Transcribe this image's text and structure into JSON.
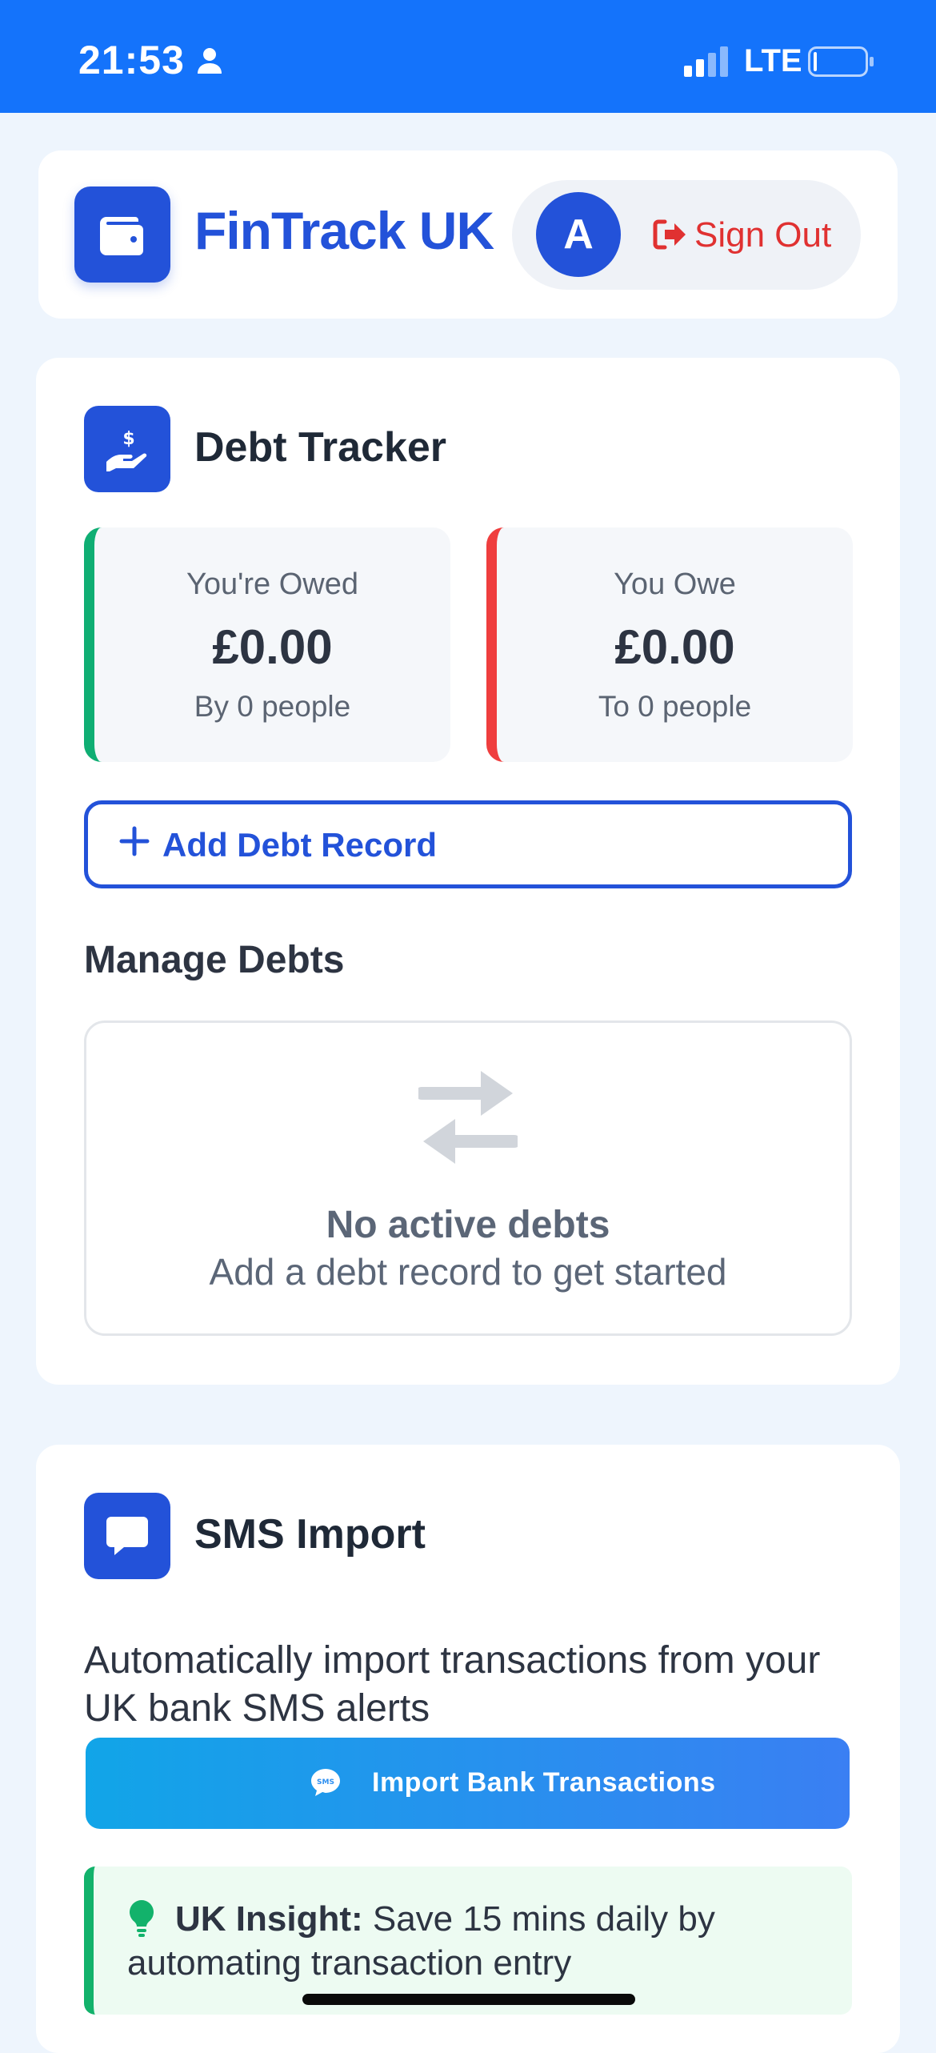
{
  "status_bar": {
    "time": "21:53",
    "network": "LTE",
    "icons": [
      "person-icon",
      "signal-icon",
      "battery-icon"
    ]
  },
  "header": {
    "brand": "FinTrack UK",
    "avatar_initial": "A",
    "sign_out_label": "Sign Out",
    "icons": [
      "wallet-icon",
      "sign-out-icon"
    ]
  },
  "debt_tracker": {
    "title": "Debt Tracker",
    "owed": {
      "label": "You're Owed",
      "amount": "£0.00",
      "sub": "By 0 people"
    },
    "owe": {
      "label": "You Owe",
      "amount": "£0.00",
      "sub": "To 0 people"
    },
    "add_button_label": "Add Debt Record",
    "manage_title": "Manage Debts",
    "empty_title": "No active debts",
    "empty_subtitle": "Add a debt record to get started",
    "icons": [
      "hand-dollar-icon",
      "plus-icon",
      "exchange-arrows-icon"
    ]
  },
  "sms_import": {
    "title": "SMS Import",
    "description": "Automatically import transactions from your UK bank SMS alerts",
    "button_label": "Import Bank Transactions",
    "insight_label": "UK Insight:",
    "insight_text": " Save 15 mins daily by automating transaction entry",
    "icons": [
      "message-icon",
      "sms-bubble-icon",
      "lightbulb-icon"
    ]
  },
  "colors": {
    "status_bar": "#1473fb",
    "brand": "#2352d9",
    "danger": "#e03131",
    "positive": "#0fae73",
    "negative": "#ef3e3e",
    "insight_bg": "#edfbf2"
  }
}
